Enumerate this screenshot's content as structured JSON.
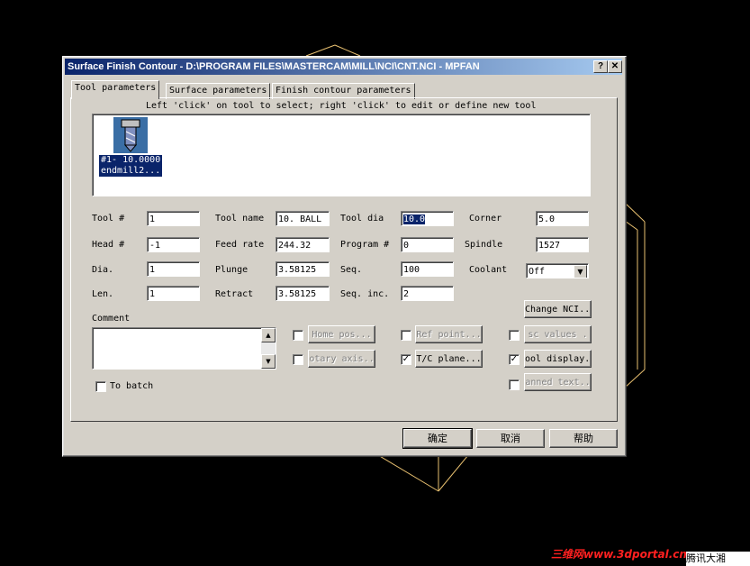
{
  "window": {
    "title": "Surface Finish Contour - D:\\PROGRAM FILES\\MASTERCAM\\MILL\\NCI\\CNT.NCI - MPFAN",
    "help_glyph": "?",
    "close_glyph": "✕"
  },
  "tabs": [
    {
      "label": "Tool parameters",
      "active": true
    },
    {
      "label": "Surface parameters",
      "active": false
    },
    {
      "label": "Finish contour parameters",
      "active": false
    }
  ],
  "tool_area": {
    "hint": "Left 'click' on tool to select; right 'click' to edit or define new tool",
    "tool_caption_line1": "#1- 10.0000",
    "tool_caption_line2": "endmill2..."
  },
  "fields": {
    "tool_num": {
      "label": "Tool #",
      "value": "1"
    },
    "head_num": {
      "label": "Head #",
      "value": "-1"
    },
    "dia": {
      "label": "Dia.",
      "value": "1"
    },
    "len": {
      "label": "Len.",
      "value": "1"
    },
    "tool_name": {
      "label": "Tool name",
      "value": "10. BALL"
    },
    "feed_rate": {
      "label": "Feed rate",
      "value": "244.32"
    },
    "plunge": {
      "label": "Plunge",
      "value": "3.58125"
    },
    "retract": {
      "label": "Retract",
      "value": "3.58125"
    },
    "tool_dia": {
      "label": "Tool dia",
      "value": "10.0"
    },
    "program_num": {
      "label": "Program #",
      "value": "0"
    },
    "seq": {
      "label": "Seq.",
      "value": "100"
    },
    "seq_inc": {
      "label": "Seq. inc.",
      "value": "2"
    },
    "corner": {
      "label": "Corner",
      "value": "5.0"
    },
    "spindle": {
      "label": "Spindle",
      "value": "1527"
    },
    "coolant": {
      "label": "Coolant",
      "value": "Off"
    }
  },
  "comment": {
    "label": "Comment"
  },
  "to_batch": {
    "label": "To batch",
    "checked": false
  },
  "options": {
    "change_nci": "Change NCI...",
    "home_pos": "Home pos...",
    "ref_point": "Ref point...",
    "misc_values": "sc values .",
    "rotary_axis": "otary axis..",
    "tc_plane": "T/C plane...",
    "tool_display": "ool display..",
    "canned_text": "anned text.."
  },
  "checks": {
    "home_pos": false,
    "ref_point": false,
    "misc_values": false,
    "rotary_axis": false,
    "tc_plane": true,
    "tool_display": true,
    "canned_text": false
  },
  "check_glyph": "✓",
  "footer": {
    "ok": "确定",
    "cancel": "取消",
    "help": "帮助"
  },
  "scroll": {
    "up_glyph": "▲",
    "down_glyph": "▼",
    "combo_glyph": "▼"
  },
  "watermark": "三维网www.3dportal.cn",
  "corner_label": "腾讯大湘"
}
